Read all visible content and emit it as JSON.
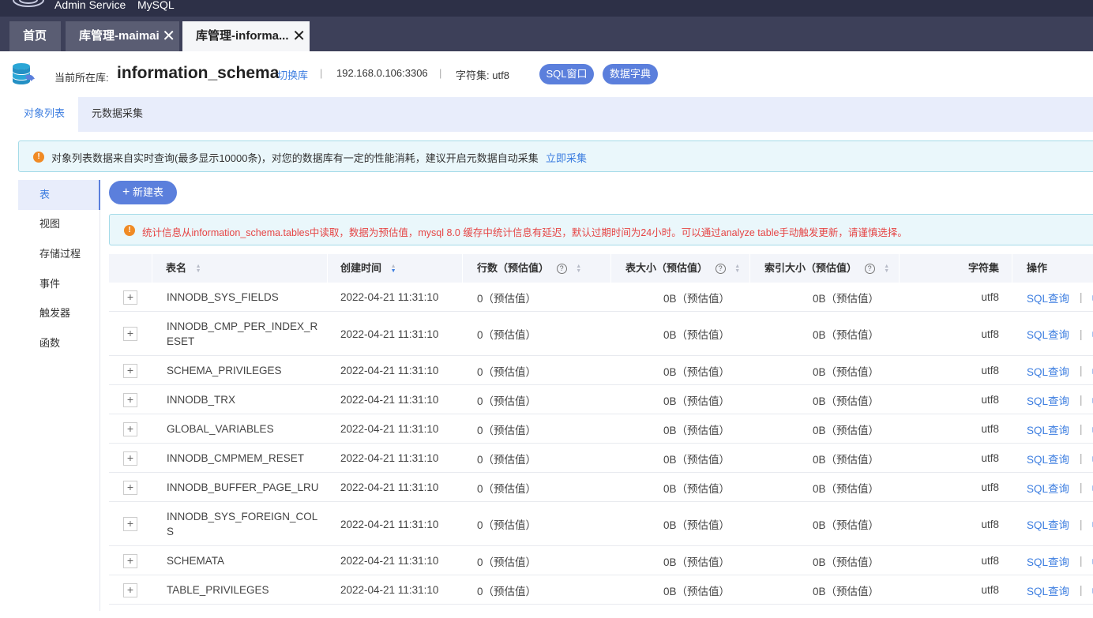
{
  "topbar": {
    "brand": "Admin Service",
    "product": "MySQL"
  },
  "tabs": [
    {
      "label": "首页",
      "closable": false,
      "active": false
    },
    {
      "label": "库管理-maimai",
      "closable": true,
      "active": false
    },
    {
      "label": "库管理-informa...",
      "closable": true,
      "active": true
    }
  ],
  "header": {
    "current_label": "当前所在库:",
    "db_name": "information_schema",
    "switch_label": "切换库",
    "host": "192.168.0.106:3306",
    "charset_label": "字符集:",
    "charset": "utf8",
    "sql_window_label": "SQL窗口",
    "data_dict_label": "数据字典"
  },
  "subtabs": [
    "对象列表",
    "元数据采集"
  ],
  "notice1": {
    "text": "对象列表数据来自实时查询(最多显示10000条)，对您的数据库有一定的性能消耗，建议开启元数据自动采集",
    "link": "立即采集"
  },
  "sidemenu": [
    "表",
    "视图",
    "存储过程",
    "事件",
    "触发器",
    "函数"
  ],
  "new_table_label": "新建表",
  "notice2": {
    "text": "统计信息从information_schema.tables中读取，数据为预估值，mysql 8.0 缓存中统计信息有延迟，默认过期时间为24小时。可以通过analyze table手动触发更新，请谨慎选择。"
  },
  "table": {
    "columns": [
      "表名",
      "创建时间",
      "行数（预估值）",
      "表大小（预估值）",
      "索引大小（预估值）",
      "字符集",
      "操作"
    ],
    "rows": [
      {
        "name": [
          "INNODB_SYS_FIELDS"
        ],
        "created": "2022-04-21 11:31:10",
        "rows": "0（预估值）",
        "size": "0B（预估值）",
        "index": "0B（预估值）",
        "charset": "utf8",
        "action": "SQL查询"
      },
      {
        "name": [
          "INNODB_CMP_PER_INDEX_R",
          "ESET"
        ],
        "created": "2022-04-21 11:31:10",
        "rows": "0（预估值）",
        "size": "0B（预估值）",
        "index": "0B（预估值）",
        "charset": "utf8",
        "action": "SQL查询"
      },
      {
        "name": [
          "SCHEMA_PRIVILEGES"
        ],
        "created": "2022-04-21 11:31:10",
        "rows": "0（预估值）",
        "size": "0B（预估值）",
        "index": "0B（预估值）",
        "charset": "utf8",
        "action": "SQL查询"
      },
      {
        "name": [
          "INNODB_TRX"
        ],
        "created": "2022-04-21 11:31:10",
        "rows": "0（预估值）",
        "size": "0B（预估值）",
        "index": "0B（预估值）",
        "charset": "utf8",
        "action": "SQL查询"
      },
      {
        "name": [
          "GLOBAL_VARIABLES"
        ],
        "created": "2022-04-21 11:31:10",
        "rows": "0（预估值）",
        "size": "0B（预估值）",
        "index": "0B（预估值）",
        "charset": "utf8",
        "action": "SQL查询"
      },
      {
        "name": [
          "INNODB_CMPMEM_RESET"
        ],
        "created": "2022-04-21 11:31:10",
        "rows": "0（预估值）",
        "size": "0B（预估值）",
        "index": "0B（预估值）",
        "charset": "utf8",
        "action": "SQL查询"
      },
      {
        "name": [
          "INNODB_BUFFER_PAGE_LRU"
        ],
        "created": "2022-04-21 11:31:10",
        "rows": "0（预估值）",
        "size": "0B（预估值）",
        "index": "0B（预估值）",
        "charset": "utf8",
        "action": "SQL查询"
      },
      {
        "name": [
          "INNODB_SYS_FOREIGN_COL",
          "S"
        ],
        "created": "2022-04-21 11:31:10",
        "rows": "0（预估值）",
        "size": "0B（预估值）",
        "index": "0B（预估值）",
        "charset": "utf8",
        "action": "SQL查询"
      },
      {
        "name": [
          "SCHEMATA"
        ],
        "created": "2022-04-21 11:31:10",
        "rows": "0（预估值）",
        "size": "0B（预估值）",
        "index": "0B（预估值）",
        "charset": "utf8",
        "action": "SQL查询"
      },
      {
        "name": [
          "TABLE_PRIVILEGES"
        ],
        "created": "2022-04-21 11:31:10",
        "rows": "0（预估值）",
        "size": "0B（预估值）",
        "index": "0B（预估值）",
        "charset": "utf8",
        "action": "SQL查询"
      }
    ]
  },
  "colors": {
    "accent": "#5b7fdc",
    "link": "#3d7ee0",
    "warning": "#f08a24",
    "alert_text": "#e64545",
    "topbar": "#2d3047"
  }
}
